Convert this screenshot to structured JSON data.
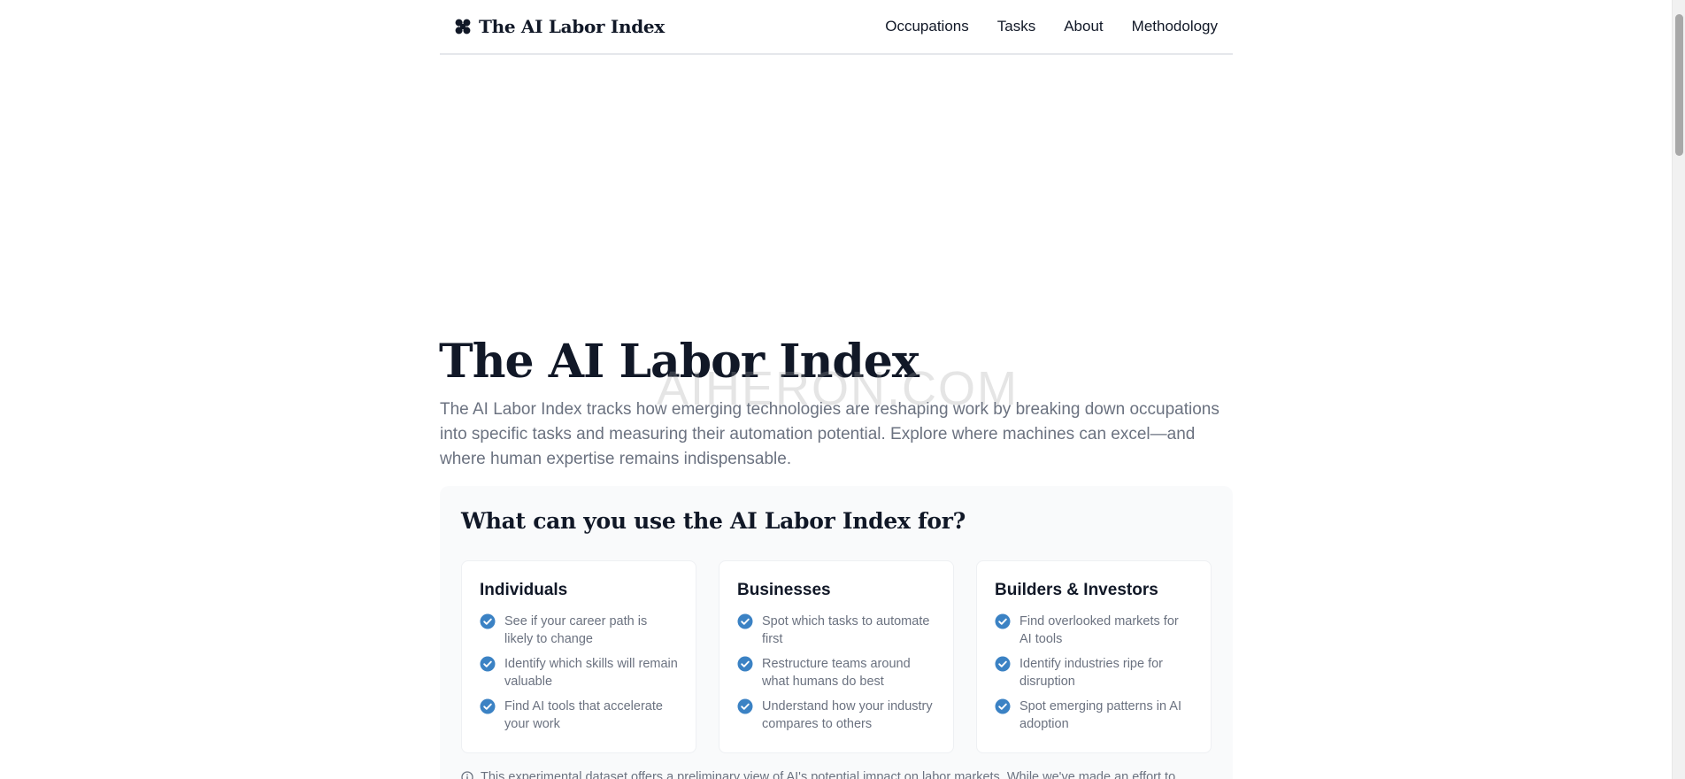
{
  "header": {
    "brand": "The AI Labor Index",
    "logo_icon": "four-petal-logo-icon",
    "nav": [
      "Occupations",
      "Tasks",
      "About",
      "Methodology"
    ]
  },
  "hero": {
    "title": "The AI Labor Index",
    "description": "The AI Labor Index tracks how emerging technologies are reshaping work by breaking down occupations into specific tasks and measuring their automation potential. Explore where machines can excel—and where human expertise remains indispensable.",
    "watermark": "AIHERON.COM"
  },
  "uses": {
    "title": "What can you use the AI Labor Index for?",
    "cards": [
      {
        "title": "Individuals",
        "items": [
          "See if your career path is likely to change",
          "Identify which skills will remain valuable",
          "Find AI tools that accelerate your work"
        ]
      },
      {
        "title": "Businesses",
        "items": [
          "Spot which tasks to automate first",
          "Restructure teams around what humans do best",
          "Understand how your industry compares to others"
        ]
      },
      {
        "title": "Builders & Investors",
        "items": [
          "Find overlooked markets for AI tools",
          "Identify industries ripe for disruption",
          "Spot emerging patterns in AI adoption"
        ]
      }
    ],
    "check_icon": "check-circle-icon",
    "accent_color": "#3b82c4"
  },
  "disclaimer": "This experimental dataset offers a preliminary view of AI's potential impact on labor markets. While we've made an effort to"
}
